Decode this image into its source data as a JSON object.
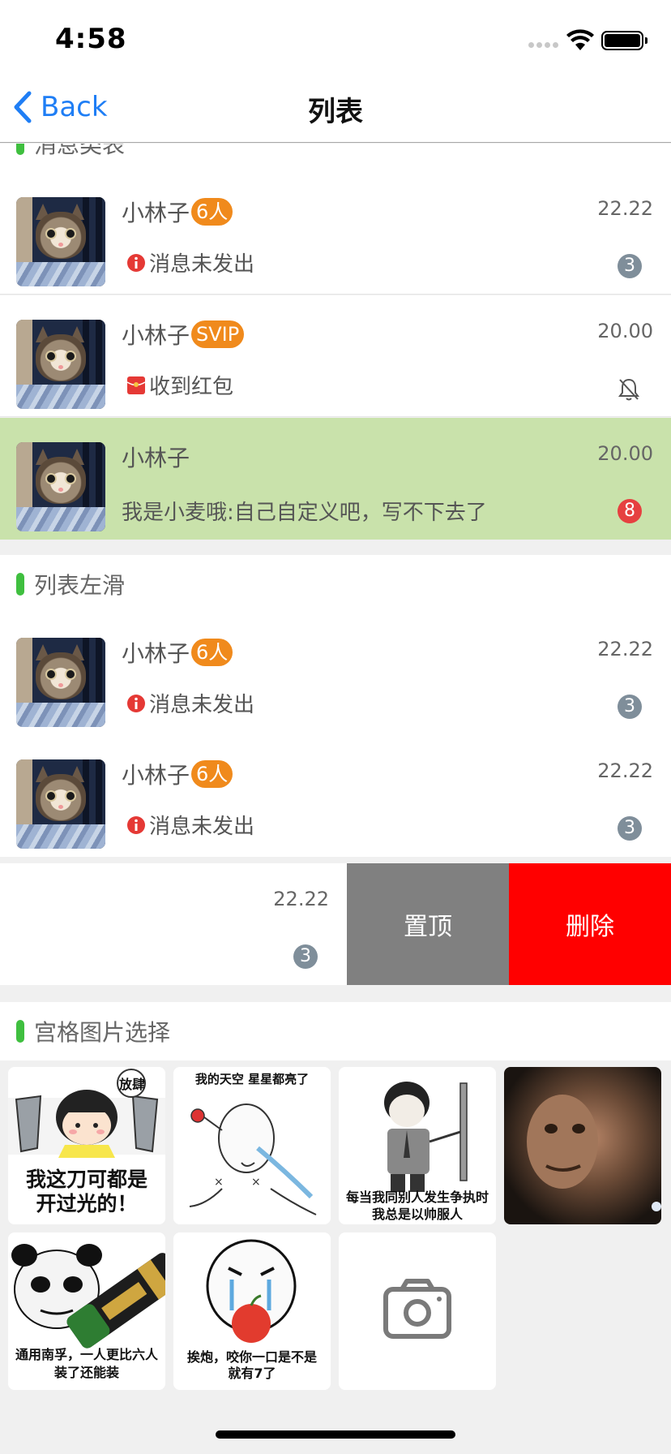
{
  "status": {
    "time": "4:58"
  },
  "nav": {
    "back_label": "Back",
    "title": "列表"
  },
  "sections": {
    "messages": "消息类表",
    "swipe": "列表左滑",
    "grid": "宫格图片选择"
  },
  "message_rows": [
    {
      "name": "小林子",
      "tag": "6人",
      "time": "22.22",
      "message": "消息未发出",
      "icon": "error-icon",
      "count": "3"
    },
    {
      "name": "小林子",
      "tag": "SVIP",
      "time": "20.00",
      "message": "收到红包",
      "icon": "red-packet-icon",
      "muted": true
    },
    {
      "name": "小林子",
      "time": "20.00",
      "message": "我是小麦哦:自己自定义吧，写不下去了",
      "count": "8",
      "highlight_color": "#c9e2ab"
    }
  ],
  "swipe_rows": [
    {
      "name": "小林子",
      "tag": "6人",
      "time": "22.22",
      "message": "消息未发出",
      "count": "3"
    },
    {
      "name": "小林子",
      "tag": "6人",
      "time": "22.22",
      "message": "消息未发出",
      "count": "3"
    },
    {
      "time": "22.22",
      "count": "3"
    }
  ],
  "swipe_actions": {
    "pin": "置顶",
    "delete": "删除"
  },
  "grid_images": [
    {
      "icon": "meme-knife-girl",
      "caption": "我这刀可都是\n开过光的！",
      "badge": "放肆"
    },
    {
      "icon": "meme-crying-stickman",
      "caption": "我的天空 星星都亮了"
    },
    {
      "icon": "meme-handsome-man",
      "caption": "每当我同别人发生争执时\n我总是以帅服人"
    },
    {
      "icon": "photo-mr-bean"
    },
    {
      "icon": "meme-panda-battery",
      "caption": "通用南孚，一人更比六人\n装了还能装"
    },
    {
      "icon": "meme-apple-bite",
      "caption": "挨炮，咬你一口是不是\n就有7了"
    },
    {
      "icon": "camera-icon"
    }
  ],
  "colors": {
    "accent": "#1f7ef5",
    "tag": "#f08a1c",
    "section_bar": "#3fbf3f",
    "delete": "#ff0000",
    "pin": "#808080"
  }
}
